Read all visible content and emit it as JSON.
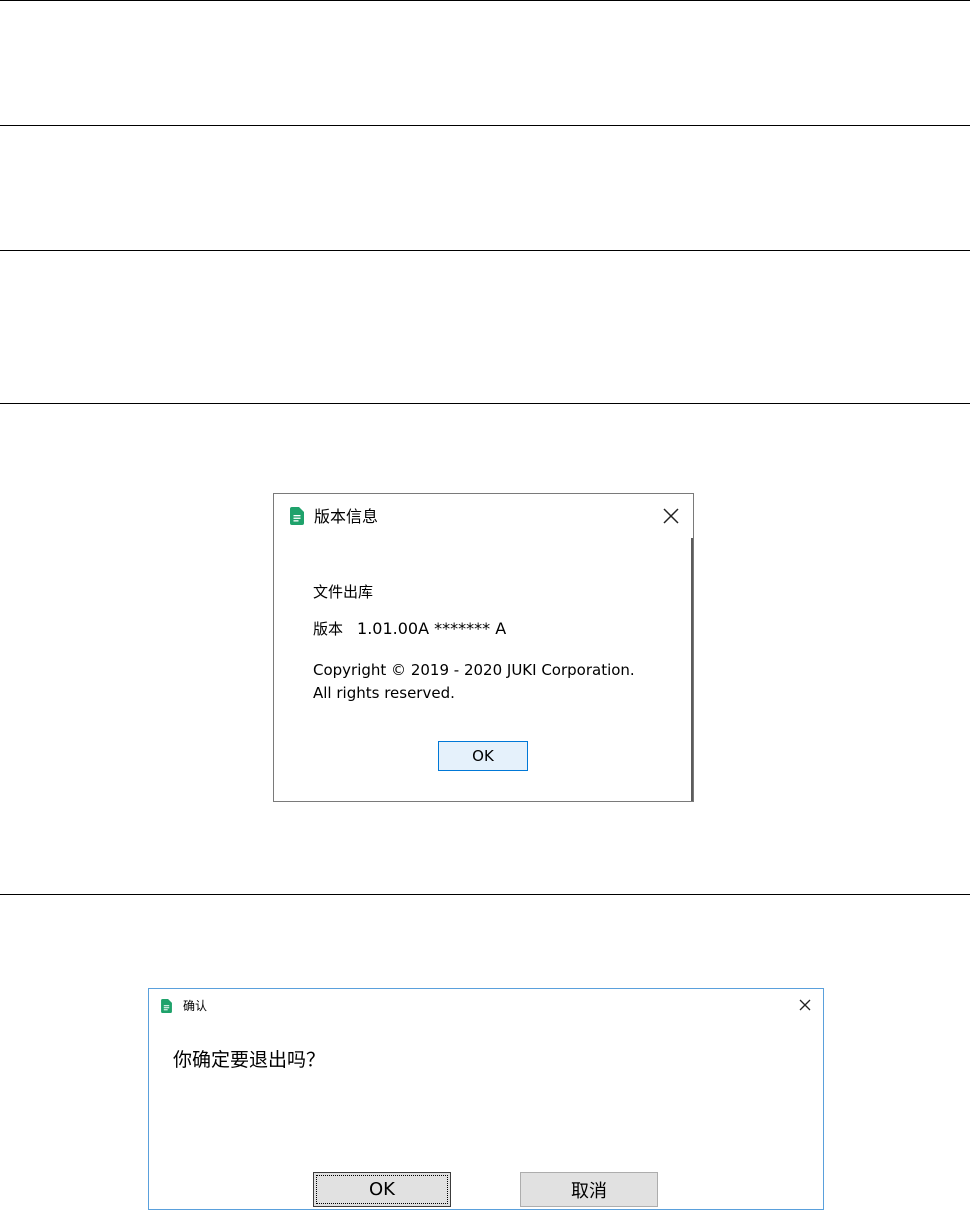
{
  "about_dialog": {
    "title": "版本信息",
    "product_name": "文件出库",
    "version_label": "版本",
    "version_value": "1.01.00A ******* A",
    "copyright_line1": "Copyright © 2019 - 2020 JUKI Corporation.",
    "copyright_line2": "All rights reserved.",
    "ok_label": "OK",
    "icon": "document-icon",
    "accent_color": "#1fa26b"
  },
  "confirm_dialog": {
    "title": "确认",
    "message": "你确定要退出吗？",
    "ok_label": "OK",
    "cancel_label": "取消",
    "icon": "document-icon",
    "accent_color": "#1fa26b"
  }
}
